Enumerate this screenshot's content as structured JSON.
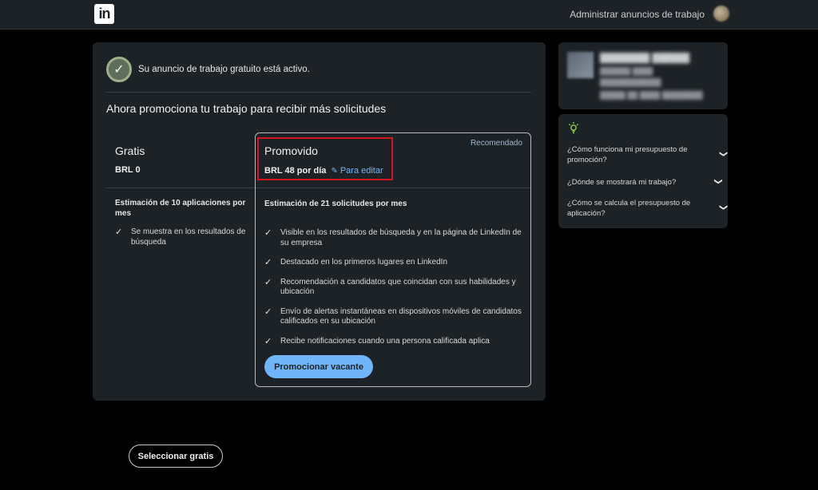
{
  "topbar": {
    "logo_text": "in",
    "manage_link": "Administrar anuncios de trabajo"
  },
  "status": {
    "text": "Su anuncio de trabajo gratuito está activo."
  },
  "headline": "Ahora promociona tu trabajo para recibir más solicitudes",
  "free_plan": {
    "title": "Gratis",
    "price": "BRL 0",
    "estimate": "Estimación de 10 aplicaciones por mes",
    "features": [
      "Se muestra en los resultados de búsqueda"
    ],
    "button": "Seleccionar gratis"
  },
  "promo_plan": {
    "badge": "Recomendado",
    "title": "Promovido",
    "price": "BRL 48 por día",
    "edit_link": "Para editar",
    "estimate": "Estimación de 21 solicitudes por mes",
    "features": [
      "Visible en los resultados de búsqueda y en la página de LinkedIn de su empresa",
      "Destacado en los primeros lugares en LinkedIn",
      "Recomendación a candidatos que coincidan con sus habilidades y ubicación",
      "Envío de alertas instantáneas en dispositivos móviles de candidatos calificados en su ubicación",
      "Recibe notificaciones cuando una persona calificada aplica"
    ],
    "button": "Promocionar vacante"
  },
  "faq": {
    "items": [
      "¿Cómo funciona mi presupuesto de promoción?",
      "¿Dónde se mostrará mi trabajo?",
      "¿Cómo se calcula el presupuesto de aplicación?"
    ]
  },
  "colors": {
    "accent": "#70b5f9",
    "highlight": "#d1161f",
    "card": "#1d2226",
    "background": "#000000"
  }
}
